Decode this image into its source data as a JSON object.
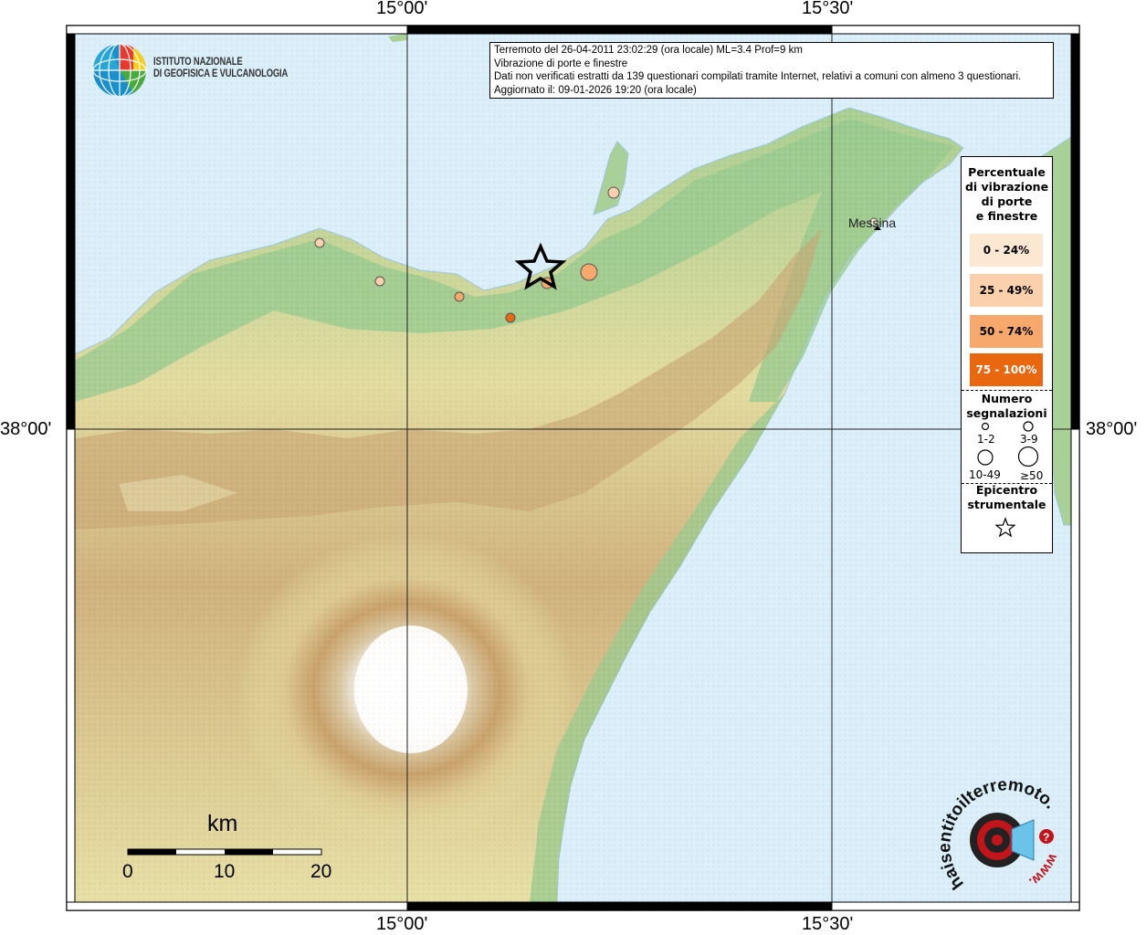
{
  "info": {
    "line1": "Terremoto del 26-04-2011 23:02:29 (ora locale) ML=3.4 Prof=9 km",
    "line2": "Vibrazione di porte e finestre",
    "line3": "Dati non verificati estratti da 139 questionari compilati tramite Internet, relativi a comuni con almeno 3 questionari.",
    "line4": "Aggiornato il: 09-01-2026 19:20 (ora locale)"
  },
  "institute": {
    "line1": "ISTITUTO NAZIONALE",
    "line2": "DI GEOFISICA E VULCANOLOGIA"
  },
  "coords": {
    "lon_a": "15°00'",
    "lon_b": "15°30'",
    "lat_a": "38°00'"
  },
  "place": {
    "messina": "Messina"
  },
  "legend": {
    "title1": "Percentuale",
    "title2": "di vibrazione",
    "title3": "di porte",
    "title4": "e finestre",
    "classes": [
      {
        "label": "0 - 24%",
        "color": "#fce7d3",
        "text": "#000000"
      },
      {
        "label": "25 - 49%",
        "color": "#fad0ad",
        "text": "#000000"
      },
      {
        "label": "50 - 74%",
        "color": "#f7a86c",
        "text": "#000000"
      },
      {
        "label": "75 - 100%",
        "color": "#e8670f",
        "text": "#ffffff"
      }
    ],
    "count_title1": "Numero",
    "count_title2": "segnalazioni",
    "sizes": [
      "1-2",
      "3-9",
      "10-49",
      "≥50"
    ],
    "epi_title1": "Epicentro",
    "epi_title2": "strumentale"
  },
  "scale": {
    "unit": "km",
    "t0": "0",
    "t1": "10",
    "t2": "20"
  },
  "brand": {
    "text": "haisentitoilterremoto.it",
    "www": "www."
  },
  "colors": {
    "sea": "#dbeffa",
    "lowland": "#8fc58e",
    "hills": "#e8e2a6",
    "mountains": "#c4a46e",
    "peak": "#ffffff",
    "epicenter": "#000000"
  }
}
